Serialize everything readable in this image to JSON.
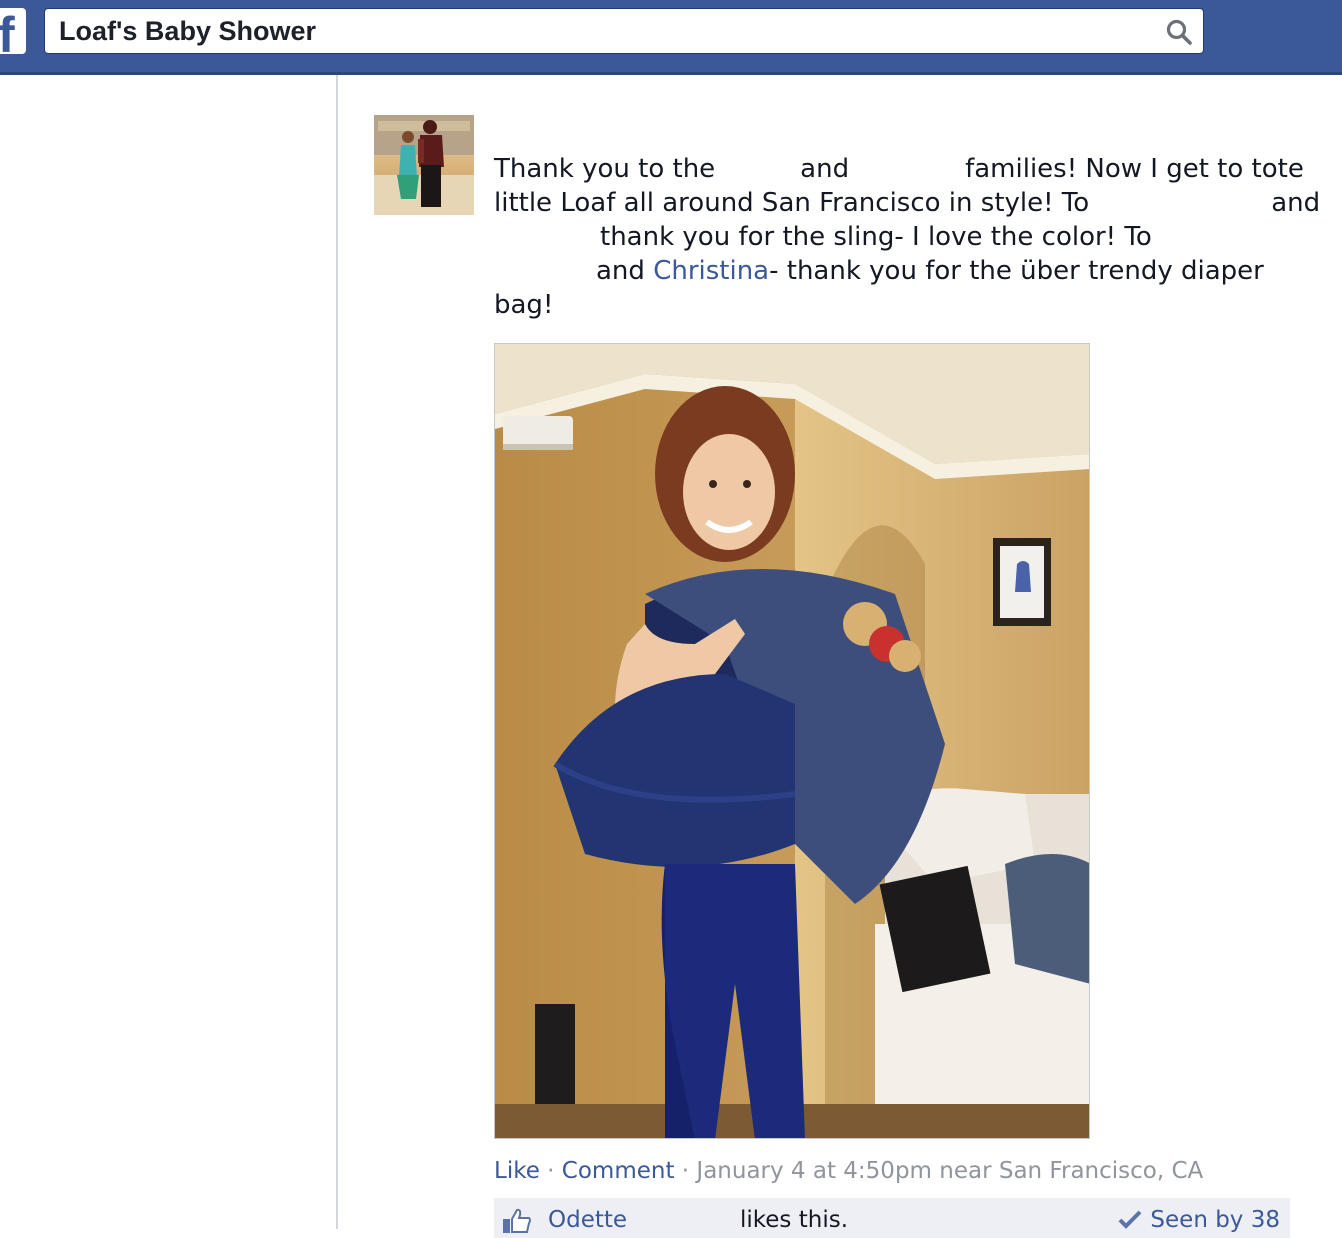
{
  "header": {
    "logo": "f",
    "search_value": "Loaf's Baby Shower",
    "search_icon": "search-icon",
    "brand_color": "#3b5998"
  },
  "post": {
    "text": {
      "line1_a": "Thank you to the",
      "line1_b": "and",
      "line1_c": "families! Now I get to tote",
      "line2_a": "little Loaf all around San Francisco in style! To",
      "line2_b": "and",
      "line3_a": "thank you for the sling- I love the color! To",
      "line4_a": "and",
      "mention": "Christina",
      "line4_b": "- thank you for the über trendy diaper",
      "line5": "bag!"
    },
    "meta": {
      "like": "Like",
      "separator": " · ",
      "comment": "Comment",
      "timestamp": "January 4 at 4:50pm near San Francisco, CA"
    },
    "likes": {
      "liker": "Odette",
      "likes_text": "likes this.",
      "seen": "Seen by 38",
      "thumb_icon": "thumbs-up-icon",
      "check_icon": "checkmark-icon"
    }
  }
}
